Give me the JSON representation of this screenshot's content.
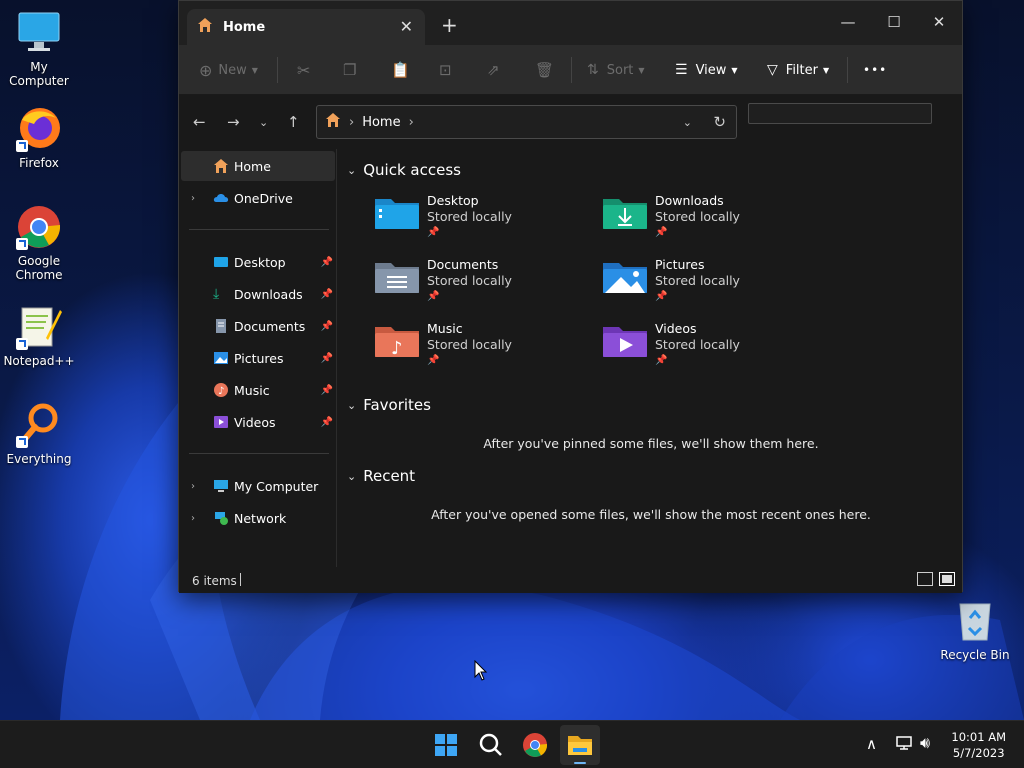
{
  "desktop": {
    "icons": [
      {
        "label": "My Computer"
      },
      {
        "label": "Firefox"
      },
      {
        "label": "Google Chrome"
      },
      {
        "label": "Notepad++"
      },
      {
        "label": "Everything"
      },
      {
        "label": "Recycle Bin"
      }
    ]
  },
  "window": {
    "tab_title": "Home",
    "new_tab": "+",
    "controls": {
      "minimize": "—",
      "maximize": "☐",
      "close": "✕"
    }
  },
  "toolbar": {
    "new_label": "New",
    "sort_label": "Sort",
    "view_label": "View",
    "filter_label": "Filter",
    "more_label": "•••"
  },
  "navigation": {
    "address_path": "Home",
    "search_placeholder": ""
  },
  "sidebar": {
    "items": [
      {
        "label": "Home"
      },
      {
        "label": "OneDrive"
      },
      {
        "label": "Desktop"
      },
      {
        "label": "Downloads"
      },
      {
        "label": "Documents"
      },
      {
        "label": "Pictures"
      },
      {
        "label": "Music"
      },
      {
        "label": "Videos"
      },
      {
        "label": "My Computer"
      },
      {
        "label": "Network"
      }
    ]
  },
  "content": {
    "quick_access": {
      "title": "Quick access",
      "items": [
        {
          "name": "Desktop",
          "sub": "Stored locally",
          "color": "#1fa4e8"
        },
        {
          "name": "Downloads",
          "sub": "Stored locally",
          "color": "#1bb58a"
        },
        {
          "name": "Documents",
          "sub": "Stored locally",
          "color": "#8696ab"
        },
        {
          "name": "Pictures",
          "sub": "Stored locally",
          "color": "#2a8fe6"
        },
        {
          "name": "Music",
          "sub": "Stored locally",
          "color": "#e9765a"
        },
        {
          "name": "Videos",
          "sub": "Stored locally",
          "color": "#8b4fd8"
        }
      ]
    },
    "favorites": {
      "title": "Favorites",
      "empty": "After you've pinned some files, we'll show them here."
    },
    "recent": {
      "title": "Recent",
      "empty": "After you've opened some files, we'll show the most recent ones here."
    }
  },
  "status": {
    "items_count": "6 items"
  },
  "taskbar": {
    "time": "10:01 AM",
    "date": "5/7/2023"
  }
}
